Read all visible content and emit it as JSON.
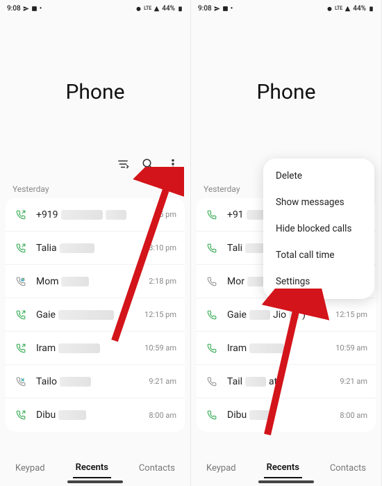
{
  "status": {
    "time": "9:08",
    "battery": "44%",
    "net": "LTE"
  },
  "title": "Phone",
  "section": "Yesterday",
  "calls": [
    {
      "name": "+919",
      "time": "55 pm",
      "dir": "out",
      "blurW1": 60,
      "blurW2": 30
    },
    {
      "name": "Talia",
      "time": "3:10 pm",
      "dir": "out",
      "blurW1": 50
    },
    {
      "name": "Mom",
      "time": "2:18 pm",
      "dir": "inout",
      "blurW1": 40
    },
    {
      "name": "Gaie",
      "time": "12:15 pm",
      "dir": "out",
      "blurW1": 80
    },
    {
      "name": "Iram",
      "time": "10:59 am",
      "dir": "out",
      "blurW1": 60
    },
    {
      "name": "Tailo",
      "time": "9:21 am",
      "dir": "inout",
      "blurW1": 45
    },
    {
      "name": "Dibu",
      "time": "8:00 am",
      "dir": "out",
      "blurW1": 40
    }
  ],
  "calls_right": [
    {
      "name": "+91",
      "time": "",
      "dir": "out",
      "extra": "",
      "blurW1": 30,
      "blurW2": 20
    },
    {
      "name": "Tali",
      "time": "",
      "dir": "out",
      "blurW1": 40
    },
    {
      "name": "Mor",
      "time": "",
      "dir": "inout",
      "blurW1": 30
    },
    {
      "name": "Gaie",
      "time": "12:15 pm",
      "dir": "out",
      "extra": "Jio",
      "blurW1": 30
    },
    {
      "name": "Iram",
      "time": "10:59 am",
      "dir": "out",
      "blurW1": 50
    },
    {
      "name": "Tail",
      "time": "9:21 am",
      "dir": "inout",
      "extra": "at",
      "blurW1": 30
    },
    {
      "name": "Dibu",
      "time": "8:00 am",
      "dir": "out",
      "blurW1": 30
    }
  ],
  "nav": {
    "keypad": "Keypad",
    "recents": "Recents",
    "contacts": "Contacts"
  },
  "menu": {
    "delete": "Delete",
    "show_messages": "Show messages",
    "hide_blocked": "Hide blocked calls",
    "total_time": "Total call time",
    "settings": "Settings"
  },
  "right_extra_close": ")",
  "right_extra_num_close": ")"
}
